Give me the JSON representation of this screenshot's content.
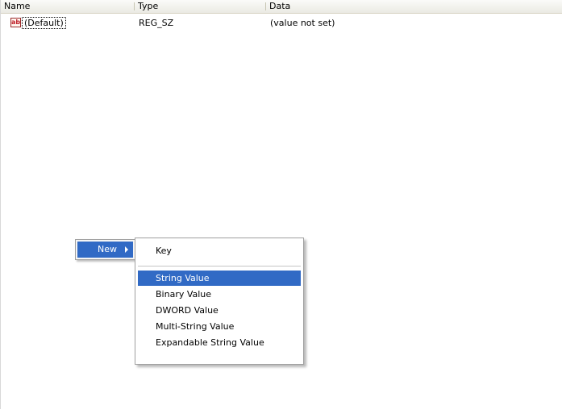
{
  "columns": {
    "name": "Name",
    "type": "Type",
    "data": "Data"
  },
  "rows": [
    {
      "icon": "string-value-icon",
      "icon_glyph": "ab",
      "name": "(Default)",
      "type": "REG_SZ",
      "data": "(value not set)"
    }
  ],
  "context_menu": {
    "new_label": "New",
    "submenu": {
      "items": [
        {
          "label": "Key"
        },
        {
          "label": "String Value",
          "highlighted": true
        },
        {
          "label": "Binary Value"
        },
        {
          "label": "DWORD Value"
        },
        {
          "label": "Multi-String Value"
        },
        {
          "label": "Expandable String Value"
        }
      ]
    }
  },
  "colors": {
    "selection": "#316ac5",
    "menu_border": "#a0a0a0",
    "icon_red": "#c0202a"
  }
}
